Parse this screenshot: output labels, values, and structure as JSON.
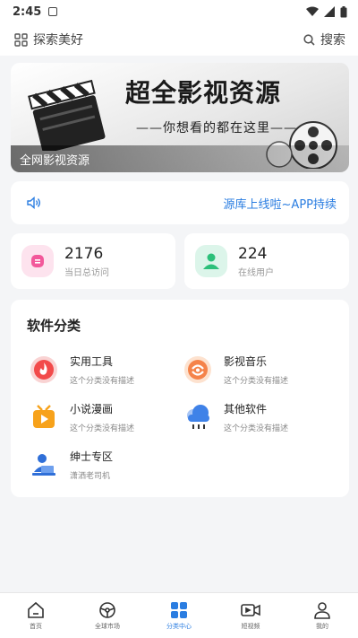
{
  "status_bar": {
    "time": "2:45"
  },
  "header": {
    "title": "探索美好",
    "search_label": "搜索"
  },
  "banner": {
    "title": "超全影视资源",
    "subtitle": "——你想看的都在这里——",
    "caption": "全网影视资源"
  },
  "notice": {
    "text": "源库上线啦~APP持续"
  },
  "stats": [
    {
      "value": "2176",
      "label": "当日总访问"
    },
    {
      "value": "224",
      "label": "在线用户"
    }
  ],
  "categories": {
    "heading": "软件分类",
    "items": [
      {
        "name": "实用工具",
        "desc": "这个分类没有描述"
      },
      {
        "name": "影视音乐",
        "desc": "这个分类没有描述"
      },
      {
        "name": "小说漫画",
        "desc": "这个分类没有描述"
      },
      {
        "name": "其他软件",
        "desc": "这个分类没有描述"
      },
      {
        "name": "绅士专区",
        "desc": "潇洒老司机"
      }
    ]
  },
  "tabs": [
    {
      "label": "首页",
      "icon": "home-icon"
    },
    {
      "label": "全球市场",
      "icon": "steering-wheel-icon"
    },
    {
      "label": "分类中心",
      "icon": "category-grid-icon",
      "active": true
    },
    {
      "label": "短视频",
      "icon": "video-camera-icon"
    },
    {
      "label": "我的",
      "icon": "user-icon"
    }
  ],
  "colors": {
    "accent": "#2a7de1",
    "stat_pink": "#fde3ee",
    "stat_green": "#dcf5ea"
  }
}
